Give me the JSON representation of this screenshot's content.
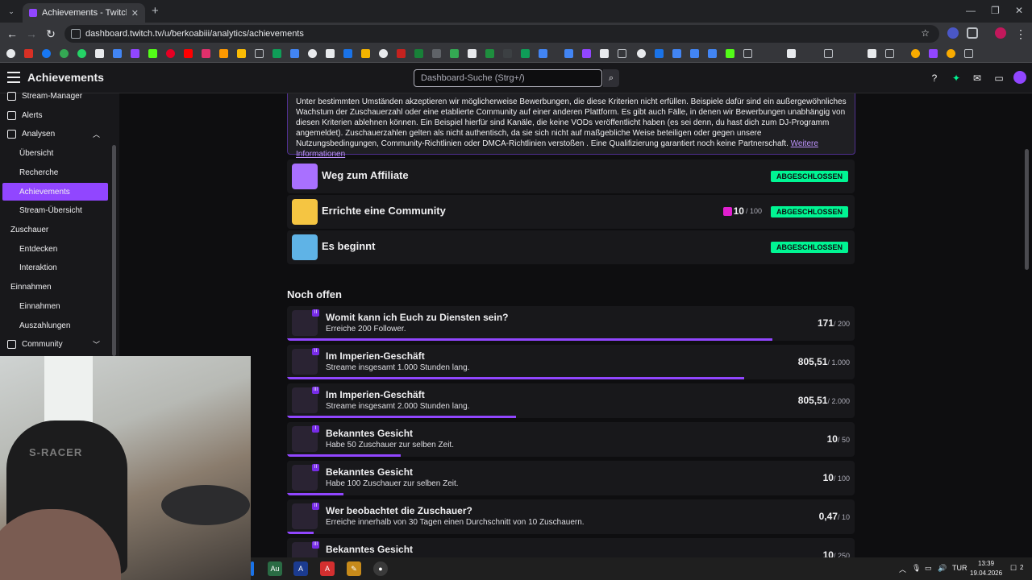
{
  "browser": {
    "tab_title": "Achievements - Twitch",
    "url": "dashboard.twitch.tv/u/berkoabiii/analytics/achievements"
  },
  "header": {
    "title": "Achievements",
    "search_placeholder": "Dashboard-Suche (Strg+/)"
  },
  "sidebar": {
    "items": [
      {
        "label": "Stream-Manager",
        "type": "top"
      },
      {
        "label": "Alerts",
        "type": "top"
      },
      {
        "label": "Analysen",
        "type": "top"
      },
      {
        "label": "Übersicht",
        "type": "sub"
      },
      {
        "label": "Recherche",
        "type": "sub"
      },
      {
        "label": "Achievements",
        "type": "sub",
        "active": true
      },
      {
        "label": "Stream-Übersicht",
        "type": "sub"
      },
      {
        "label": "Zuschauer",
        "type": "cat"
      },
      {
        "label": "Entdecken",
        "type": "sub"
      },
      {
        "label": "Interaktion",
        "type": "sub"
      },
      {
        "label": "Einnahmen",
        "type": "cat"
      },
      {
        "label": "Einnahmen",
        "type": "sub"
      },
      {
        "label": "Auszahlungen",
        "type": "sub"
      },
      {
        "label": "Community",
        "type": "top"
      }
    ]
  },
  "webcam": {
    "chair_text": "S-RACER"
  },
  "info": {
    "text": "Unter bestimmten Umständen akzeptieren wir möglicherweise Bewerbungen, die diese Kriterien nicht erfüllen. Beispiele dafür sind ein außergewöhnliches Wachstum der Zuschauerzahl oder eine etablierte Community auf einer anderen Plattform. Es gibt auch Fälle, in denen wir Bewerbungen unabhängig von diesen Kriterien ablehnen können. Ein Beispiel hierfür sind Kanäle, die keine VODs veröffentlicht haben (es sei denn, du hast dich zum DJ-Programm angemeldet). Zuschauerzahlen gelten als nicht authentisch, da sie sich nicht auf maßgebliche Weise beteiligen oder gegen unsere Nutzungsbedingungen, Community-Richtlinien oder DMCA-Richtlinien verstoßen . Eine Qualifizierung garantiert noch keine Partnerschaft.",
    "link": "Weitere Informationen"
  },
  "completed": [
    {
      "name": "Weg zum Affiliate",
      "status": "ABGESCHLOSSEN",
      "color": "#a970ff"
    },
    {
      "name": "Errichte eine Community",
      "status": "ABGESCHLOSSEN",
      "color": "#f5c542",
      "count": "10",
      "total": "/ 100"
    },
    {
      "name": "Es beginnt",
      "status": "ABGESCHLOSSEN",
      "color": "#5fb3e6"
    }
  ],
  "open_title": "Noch offen",
  "open": [
    {
      "tier": "II",
      "name": "Womit kann ich Euch zu Diensten sein?",
      "desc": "Erreiche 200 Follower.",
      "value": "171",
      "total": "/ 200",
      "progress": 0.855
    },
    {
      "tier": "II",
      "name": "Im Imperien-Geschäft",
      "desc": "Streame insgesamt 1.000 Stunden lang.",
      "value": "805,51",
      "total": "/ 1.000",
      "progress": 0.805
    },
    {
      "tier": "III",
      "name": "Im Imperien-Geschäft",
      "desc": "Streame insgesamt 2.000 Stunden lang.",
      "value": "805,51",
      "total": "/ 2.000",
      "progress": 0.403
    },
    {
      "tier": "I",
      "name": "Bekanntes Gesicht",
      "desc": "Habe 50 Zuschauer zur selben Zeit.",
      "value": "10",
      "total": "/ 50",
      "progress": 0.2
    },
    {
      "tier": "II",
      "name": "Bekanntes Gesicht",
      "desc": "Habe 100 Zuschauer zur selben Zeit.",
      "value": "10",
      "total": "/ 100",
      "progress": 0.1
    },
    {
      "tier": "II",
      "name": "Wer beobachtet die Zuschauer?",
      "desc": "Erreiche innerhalb von 30 Tagen einen Durchschnitt von 10 Zuschauern.",
      "value": "0,47",
      "total": "/ 10",
      "progress": 0.047
    },
    {
      "tier": "III",
      "name": "Bekanntes Gesicht",
      "desc": "",
      "value": "10",
      "total": "/ 250",
      "progress": 0.04
    }
  ],
  "taskbar": {
    "lang": "TUR",
    "time": "13:39",
    "date": "19.04.2026",
    "notifications": "2"
  }
}
